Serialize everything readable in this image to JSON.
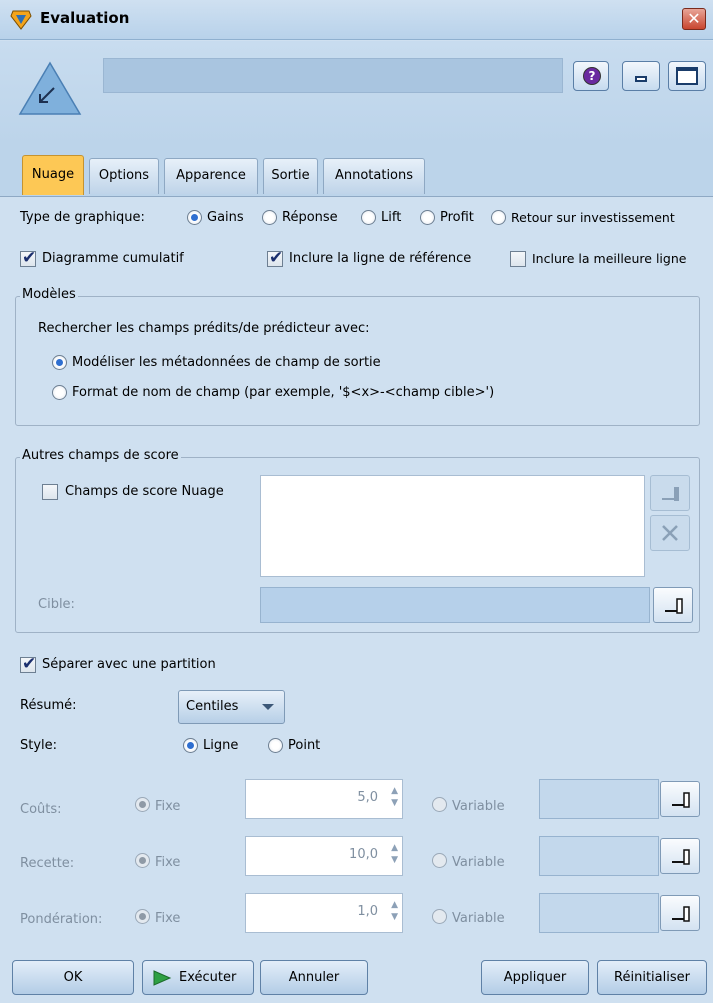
{
  "window": {
    "title": "Evaluation",
    "close_glyph": "✕"
  },
  "header": {
    "node_name": ""
  },
  "tabs": [
    "Nuage",
    "Options",
    "Apparence",
    "Sortie",
    "Annotations"
  ],
  "chart_type": {
    "label": "Type de graphique:",
    "options": [
      "Gains",
      "Réponse",
      "Lift",
      "Profit",
      "Retour sur investissement"
    ],
    "selected": "Gains"
  },
  "checkboxes": {
    "cumulative": {
      "label": "Diagramme cumulatif",
      "checked": true
    },
    "reference_line": {
      "label": "Inclure la ligne de référence",
      "checked": true
    },
    "best_line": {
      "label": "Inclure la meilleure ligne",
      "checked": false
    }
  },
  "models": {
    "title": "Modèles",
    "prompt": "Rechercher les champs prédits/de prédicteur avec:",
    "options": [
      "Modéliser les métadonnées de champ de sortie",
      "Format de nom de champ (par exemple, '$<x>-<champ cible>')"
    ],
    "selected": "Modéliser les métadonnées de champ de sortie"
  },
  "other_scores": {
    "title": "Autres champs de score",
    "checkbox_label": "Champs de score Nuage",
    "checked": false,
    "target_label": "Cible:"
  },
  "partition": {
    "label": "Séparer avec une partition",
    "checked": true
  },
  "summary": {
    "label": "Résumé:",
    "value": "Centiles"
  },
  "style": {
    "label": "Style:",
    "options": [
      "Ligne",
      "Point"
    ],
    "selected": "Ligne"
  },
  "costs": {
    "fixed_label": "Fixe",
    "variable_label": "Variable",
    "rows": [
      {
        "label": "Coûts:",
        "value": "5,0"
      },
      {
        "label": "Recette:",
        "value": "10,0"
      },
      {
        "label": "Pondération:",
        "value": "1,0"
      }
    ]
  },
  "buttons": {
    "ok": "OK",
    "run": "Exécuter",
    "cancel": "Annuler",
    "apply": "Appliquer",
    "reset": "Réinitialiser"
  },
  "colors": {
    "active_tab": "#fdc855",
    "background": "#cfe0f0",
    "radio_selected": "#2f6fd0"
  }
}
